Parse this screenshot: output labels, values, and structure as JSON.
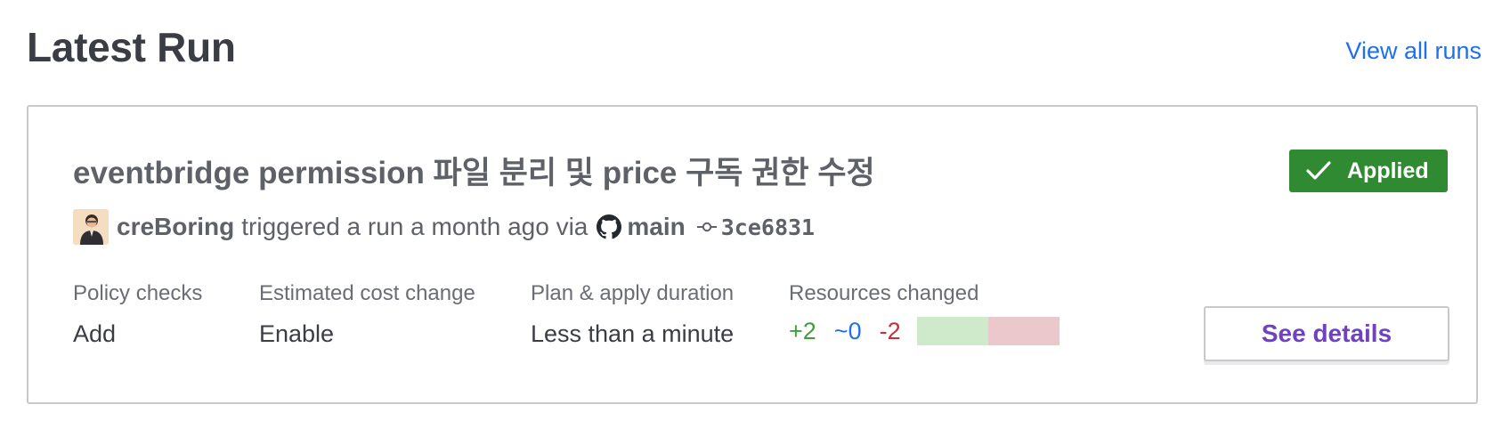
{
  "header": {
    "title": "Latest Run",
    "view_all_label": "View all runs"
  },
  "run": {
    "title": "eventbridge permission 파일 분리 및 price 구독 권한 수정",
    "status": "Applied",
    "user": "creBoring",
    "action_text": "triggered a run a month ago via",
    "branch": "main",
    "commit": "3ce6831",
    "icons": [
      "checkmark-icon",
      "user-avatar",
      "github-icon",
      "git-commit-icon"
    ],
    "colors": {
      "status_bg": "#2f8a32",
      "link": "#1f6feb",
      "details_text": "#6e42c1",
      "added": "#3fa03a",
      "changed": "#1f6feb",
      "destroyed": "#c4303a"
    }
  },
  "stats": {
    "policy_checks": {
      "label": "Policy checks",
      "value": "Add"
    },
    "cost_change": {
      "label": "Estimated cost change",
      "value": "Enable"
    },
    "duration": {
      "label": "Plan & apply duration",
      "value": "Less than a minute"
    },
    "resources": {
      "label": "Resources changed",
      "added": "+2",
      "changed": "~0",
      "destroyed": "-2",
      "added_count": 2,
      "changed_count": 0,
      "destroyed_count": 2
    }
  },
  "actions": {
    "see_details_label": "See details"
  }
}
